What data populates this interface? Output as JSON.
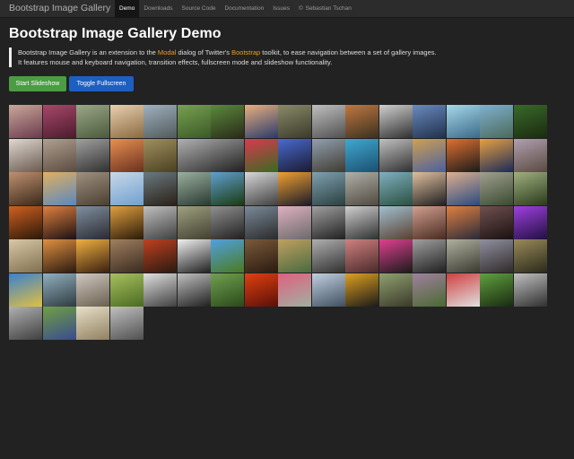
{
  "navbar": {
    "brand": "Bootstrap Image Gallery",
    "items": [
      {
        "label": "Demo",
        "active": true,
        "icon": ""
      },
      {
        "label": "Downloads",
        "active": false,
        "icon": ""
      },
      {
        "label": "Source Code",
        "active": false,
        "icon": ""
      },
      {
        "label": "Documentation",
        "active": false,
        "icon": ""
      },
      {
        "label": "Issues",
        "active": false,
        "icon": ""
      },
      {
        "label": "Sebastian Tschan",
        "active": false,
        "icon": "copyright-icon"
      }
    ]
  },
  "page": {
    "title": "Bootstrap Image Gallery Demo",
    "lead": {
      "part1": "Bootstrap Image Gallery is an extension to the ",
      "link1": "Modal",
      "part2": " dialog of Twitter's ",
      "link2": "Bootstrap",
      "part3": " toolkit, to ease navigation between a set of gallery images.",
      "line2": "It features mouse and keyboard navigation, transition effects, fullscreen mode and slideshow functionality."
    },
    "buttons": {
      "slideshow": "Start Slideshow",
      "fullscreen": "Toggle Fullscreen"
    }
  },
  "colors": {
    "background": "#222222",
    "link": "#ef9f1c",
    "success": "#4b9c43",
    "primary": "#1d5fc1"
  },
  "gallery": {
    "thumbnails": [
      {
        "c1": "#c9a89a",
        "c2": "#6b3a4c"
      },
      {
        "c1": "#a8476a",
        "c2": "#4a1c2c"
      },
      {
        "c1": "#9aa888",
        "c2": "#4a5a3a"
      },
      {
        "c1": "#e8d0b0",
        "c2": "#8a6a40"
      },
      {
        "c1": "#a0b0c0",
        "c2": "#505a5a"
      },
      {
        "c1": "#78a050",
        "c2": "#3a5a28"
      },
      {
        "c1": "#5a8a3a",
        "c2": "#2a2a1a"
      },
      {
        "c1": "#e8b080",
        "c2": "#2a3a6a"
      },
      {
        "c1": "#8a8a6a",
        "c2": "#3a3a2a"
      },
      {
        "c1": "#c0c0c0",
        "c2": "#505050"
      },
      {
        "c1": "#c07840",
        "c2": "#3a3020"
      },
      {
        "c1": "#d0d0d0",
        "c2": "#303030"
      },
      {
        "c1": "#6a8ac0",
        "c2": "#20304a"
      },
      {
        "c1": "#a8d8e8",
        "c2": "#3a6a8a"
      },
      {
        "c1": "#80b0d0",
        "c2": "#4a6a5a"
      },
      {
        "c1": "#3a6a2a",
        "c2": "#1a2a10"
      },
      {
        "c1": "#e0d8d0",
        "c2": "#6a5a50"
      },
      {
        "c1": "#b0a090",
        "c2": "#5a4a40"
      },
      {
        "c1": "#a0a0a0",
        "c2": "#303030"
      },
      {
        "c1": "#e89050",
        "c2": "#6a3020"
      },
      {
        "c1": "#a09060",
        "c2": "#4a4020"
      },
      {
        "c1": "#b0b0b0",
        "c2": "#404040"
      },
      {
        "c1": "#909090",
        "c2": "#202020"
      },
      {
        "c1": "#d83a50",
        "c2": "#3a6a20"
      },
      {
        "c1": "#4a6ad0",
        "c2": "#1a1a30"
      },
      {
        "c1": "#90a0b0",
        "c2": "#403a30"
      },
      {
        "c1": "#40a8d0",
        "c2": "#1a5070"
      },
      {
        "c1": "#c0c0c0",
        "c2": "#303030"
      },
      {
        "c1": "#d0a050",
        "c2": "#4a60a0"
      },
      {
        "c1": "#e07030",
        "c2": "#1a1a1a"
      },
      {
        "c1": "#e8a040",
        "c2": "#1a2a5a"
      },
      {
        "c1": "#b0a0b0",
        "c2": "#5a4a40"
      },
      {
        "c1": "#c09070",
        "c2": "#3a2a1a"
      },
      {
        "c1": "#e0b060",
        "c2": "#5a88c0"
      },
      {
        "c1": "#a09080",
        "c2": "#4a4030"
      },
      {
        "c1": "#c8d8e8",
        "c2": "#70a0d0"
      },
      {
        "c1": "#6a7a80",
        "c2": "#2a2018"
      },
      {
        "c1": "#9ab0a0",
        "c2": "#2a3a30"
      },
      {
        "c1": "#60a0d0",
        "c2": "#1a3a10"
      },
      {
        "c1": "#d8d8d8",
        "c2": "#404040"
      },
      {
        "c1": "#f0a030",
        "c2": "#1a1a2a"
      },
      {
        "c1": "#80a0b0",
        "c2": "#2a4040"
      },
      {
        "c1": "#b0b0a8",
        "c2": "#504a40"
      },
      {
        "c1": "#80b0c0",
        "c2": "#2a5040"
      },
      {
        "c1": "#e0c0a0",
        "c2": "#202020"
      },
      {
        "c1": "#e0b090",
        "c2": "#2a4a80"
      },
      {
        "c1": "#a0a090",
        "c2": "#3a4a30"
      },
      {
        "c1": "#a0b080",
        "c2": "#2a3a1a"
      },
      {
        "c1": "#d06020",
        "c2": "#2a1808"
      },
      {
        "c1": "#e08040",
        "c2": "#1a1010"
      },
      {
        "c1": "#8090a0",
        "c2": "#2a2a30"
      },
      {
        "c1": "#e0a040",
        "c2": "#2a1a08"
      },
      {
        "c1": "#c0c0c0",
        "c2": "#404040"
      },
      {
        "c1": "#a0a080",
        "c2": "#404030"
      },
      {
        "c1": "#909090",
        "c2": "#202020"
      },
      {
        "c1": "#7a8a9a",
        "c2": "#2a2a2a"
      },
      {
        "c1": "#e0b0c0",
        "c2": "#6a6a6a"
      },
      {
        "c1": "#a0a0a0",
        "c2": "#202020"
      },
      {
        "c1": "#d0d0d0",
        "c2": "#303030"
      },
      {
        "c1": "#a0c0d0",
        "c2": "#5a4030"
      },
      {
        "c1": "#d0a090",
        "c2": "#4a2a20"
      },
      {
        "c1": "#e08040",
        "c2": "#2a2a3a"
      },
      {
        "c1": "#705050",
        "c2": "#1a1010"
      },
      {
        "c1": "#a040e0",
        "c2": "#201040"
      },
      {
        "c1": "#d8c8a8",
        "c2": "#807050"
      },
      {
        "c1": "#e09040",
        "c2": "#2a1a10"
      },
      {
        "c1": "#f0b040",
        "c2": "#3a2010"
      },
      {
        "c1": "#a08060",
        "c2": "#3a2a20"
      },
      {
        "c1": "#c04020",
        "c2": "#2a1a10"
      },
      {
        "c1": "#f0f0f0",
        "c2": "#202020"
      },
      {
        "c1": "#50a0e0",
        "c2": "#4a7a20"
      },
      {
        "c1": "#7a5a3a",
        "c2": "#2a1a10"
      },
      {
        "c1": "#c0a060",
        "c2": "#4a6a40"
      },
      {
        "c1": "#b0b0b0",
        "c2": "#303030"
      },
      {
        "c1": "#d08080",
        "c2": "#4a2a2a"
      },
      {
        "c1": "#e04090",
        "c2": "#1a1a1a"
      },
      {
        "c1": "#a0a0a0",
        "c2": "#202020"
      },
      {
        "c1": "#b0b0a0",
        "c2": "#3a3a30"
      },
      {
        "c1": "#9090a0",
        "c2": "#302a2a"
      },
      {
        "c1": "#9a8a5a",
        "c2": "#2a2a1a"
      },
      {
        "c1": "#3a80d0",
        "c2": "#e0c040"
      },
      {
        "c1": "#90b0c0",
        "c2": "#303a40"
      },
      {
        "c1": "#d0c8c0",
        "c2": "#6a6050"
      },
      {
        "c1": "#a8c060",
        "c2": "#4a6a20"
      },
      {
        "c1": "#e0e0e0",
        "c2": "#404040"
      },
      {
        "c1": "#c0c0c0",
        "c2": "#202020"
      },
      {
        "c1": "#70a050",
        "c2": "#2a4a1a"
      },
      {
        "c1": "#e04010",
        "c2": "#5a1008"
      },
      {
        "c1": "#e06080",
        "c2": "#a0b0a0"
      },
      {
        "c1": "#c0d0e0",
        "c2": "#405060"
      },
      {
        "c1": "#e0a020",
        "c2": "#1a1a1a"
      },
      {
        "c1": "#90a070",
        "c2": "#3a3a2a"
      },
      {
        "c1": "#a080a0",
        "c2": "#4a6a30"
      },
      {
        "c1": "#d04040",
        "c2": "#e0e0e0"
      },
      {
        "c1": "#60a040",
        "c2": "#1a2a10"
      },
      {
        "c1": "#c0c0c0",
        "c2": "#303030"
      },
      {
        "c1": "#b0b0b0",
        "c2": "#404040"
      },
      {
        "c1": "#70a040",
        "c2": "#3a4a90"
      },
      {
        "c1": "#e8e0c8",
        "c2": "#908060"
      },
      {
        "c1": "#c0c0c0",
        "c2": "#505050"
      }
    ]
  }
}
